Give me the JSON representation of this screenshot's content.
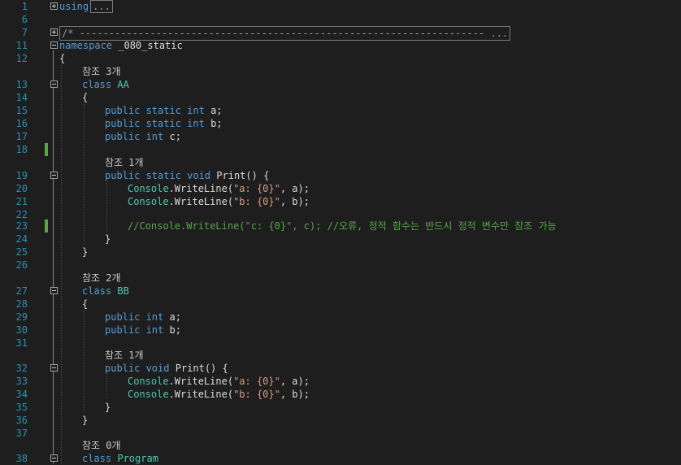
{
  "code": {
    "using_kw": "using",
    "using_collapsed": "...",
    "comment_collapsed": "/* --------------------------------------------------------------------- ...",
    "ns_kw": "namespace",
    "ns_name": " _080_static",
    "open_brace": "{",
    "close_brace": "}",
    "ref_3": "참조 3개",
    "ref_2": "참조 2개",
    "ref_1": "참조 1개",
    "ref_0": "참조 0개",
    "class_kw": "class",
    "class_aa": " AA",
    "class_bb": " BB",
    "class_program": " Program",
    "public_kw": "public",
    "static_kw": " static",
    "int_kw": " int",
    "void_kw": " void",
    "var_a": " a;",
    "var_b": " b;",
    "var_c": " c;",
    "print_sig": " Print() {",
    "console": "Console",
    "writeline": ".WriteLine(",
    "str_a": "\"a: {0}\"",
    "str_b": "\"b: {0}\"",
    "args_a": ", a);",
    "args_b": ", b);",
    "error_comment": "//Console.WriteLine(\"c: {0}\", c); //오류, 정적 함수는 반드시 정적 변수만 참조 가능"
  },
  "line_numbers": [
    "1",
    "6",
    "7",
    "11",
    "12",
    "13",
    "14",
    "15",
    "16",
    "17",
    "18",
    "19",
    "20",
    "21",
    "22",
    "23",
    "24",
    "25",
    "26",
    "27",
    "28",
    "29",
    "30",
    "31",
    "32",
    "33",
    "34",
    "35",
    "36",
    "37",
    "38"
  ]
}
